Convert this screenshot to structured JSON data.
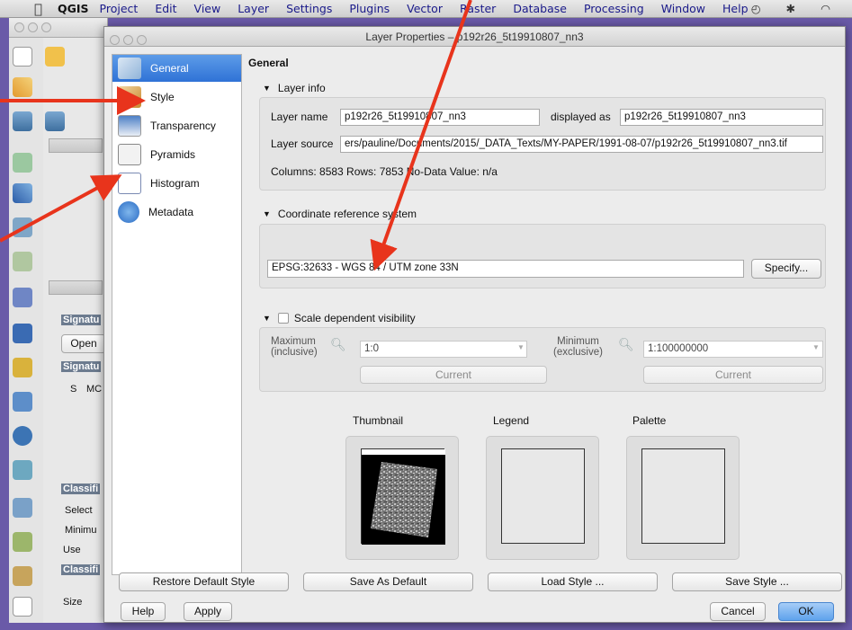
{
  "menubar": {
    "app_name": "QGIS",
    "items": [
      "Project",
      "Edit",
      "View",
      "Layer",
      "Settings",
      "Plugins",
      "Vector",
      "Raster",
      "Database",
      "Processing",
      "Window",
      "Help"
    ]
  },
  "background_app": {
    "panel_labels": {
      "signatu1": "Signatu",
      "open": "Open",
      "signatu2": "Signatu",
      "s": "S",
      "mc": "MC",
      "classifi1": "Classifi",
      "select": "Select",
      "minim": "Minimu",
      "use": "Use",
      "classifi2": "Classifi",
      "size": "Size"
    }
  },
  "dialog": {
    "title": "Layer Properties – p192r26_5t19910807_nn3",
    "sidebar": [
      {
        "label": "General",
        "icon": "general-tools-icon",
        "selected": true
      },
      {
        "label": "Style",
        "icon": "style-brush-icon",
        "selected": false
      },
      {
        "label": "Transparency",
        "icon": "transparency-icon",
        "selected": false
      },
      {
        "label": "Pyramids",
        "icon": "pyramids-icon",
        "selected": false
      },
      {
        "label": "Histogram",
        "icon": "histogram-icon",
        "selected": false
      },
      {
        "label": "Metadata",
        "icon": "metadata-info-icon",
        "selected": false
      }
    ],
    "general": {
      "heading": "General",
      "layer_info": {
        "header": "Layer info",
        "layer_name_label": "Layer name",
        "layer_name_value": "p192r26_5t19910807_nn3",
        "displayed_as_label": "displayed as",
        "displayed_as_value": "p192r26_5t19910807_nn3",
        "layer_source_label": "Layer source",
        "layer_source_value": "ers/pauline/Documents/2015/_DATA_Texts/MY-PAPER/1991-08-07/p192r26_5t19910807_nn3.tif",
        "stats": "Columns: 8583  Rows: 7853  No-Data Value: n/a"
      },
      "crs": {
        "header": "Coordinate reference system",
        "value": "EPSG:32633 - WGS 84 / UTM zone 33N",
        "specify_button": "Specify..."
      },
      "scale": {
        "header": "Scale dependent visibility",
        "checked": false,
        "maximum_label": "Maximum\n(inclusive)",
        "maximum_value": "1:0",
        "minimum_label": "Minimum\n(exclusive)",
        "minimum_value": "1:100000000",
        "current_button": "Current",
        "current_button_2": "Current"
      },
      "previews": {
        "thumbnail_label": "Thumbnail",
        "legend_label": "Legend",
        "palette_label": "Palette"
      }
    },
    "buttons": {
      "restore_default": "Restore Default Style",
      "save_as_default": "Save As Default",
      "load_style": "Load Style ...",
      "save_style": "Save Style ...",
      "help": "Help",
      "apply": "Apply",
      "cancel": "Cancel",
      "ok": "OK"
    }
  },
  "colors": {
    "accent_selection": "#3a7fdc",
    "annotation_arrow": "#e8341c",
    "frame": "#6f5cb4"
  }
}
